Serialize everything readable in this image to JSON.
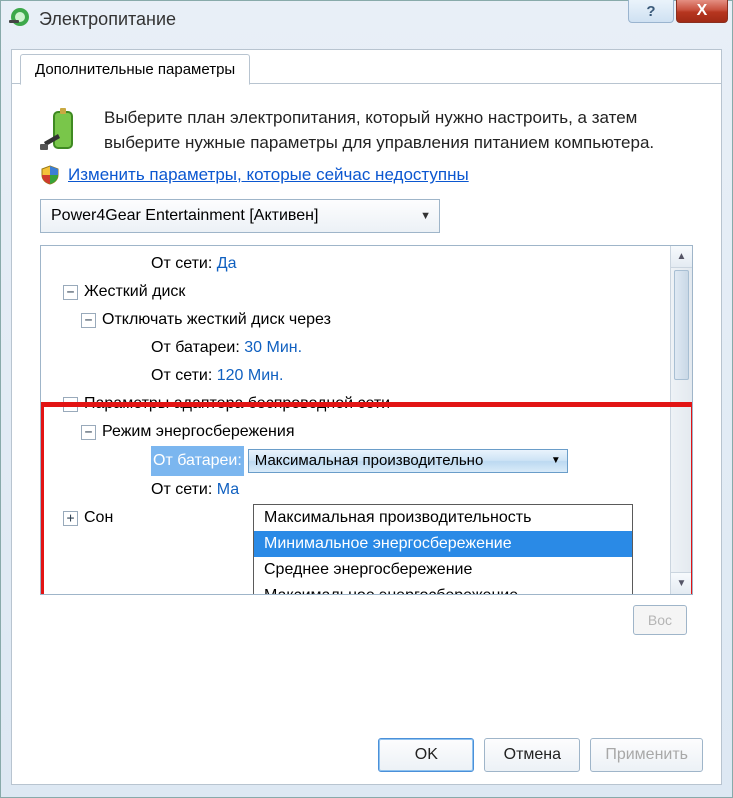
{
  "window": {
    "title": "Электропитание"
  },
  "tab": {
    "label": "Дополнительные параметры"
  },
  "intro": {
    "text": "Выберите план электропитания, который нужно настроить, а затем выберите нужные параметры для управления питанием компьютера."
  },
  "uac": {
    "link_text": "Изменить параметры, которые сейчас недоступны"
  },
  "plan_combo": {
    "selected": "Power4Gear Entertainment [Активен]"
  },
  "tree": {
    "row0": {
      "label": "От сети:",
      "value": "Да"
    },
    "hard_disk": {
      "label": "Жесткий диск",
      "turn_off": {
        "label": "Отключать жесткий диск через",
        "battery": {
          "label": "От батареи:",
          "value": "30 Мин."
        },
        "plugged": {
          "label": "От сети:",
          "value": "120 Мин."
        }
      }
    },
    "wifi": {
      "label": "Параметры адаптера беспроводной сети",
      "mode": {
        "label": "Режим энергосбережения",
        "battery": {
          "label": "От батареи:",
          "value": "Максимальная производительно"
        },
        "plugged": {
          "label": "От сети:",
          "value_prefix": "Ма"
        }
      }
    },
    "sleep": {
      "label": "Сон"
    }
  },
  "dropdown": {
    "opt0": "Максимальная производительность",
    "opt1": "Минимальное энергосбережение",
    "opt2": "Среднее энергосбережение",
    "opt3": "Максимальное энергосбережение"
  },
  "buttons": {
    "restore_partial": "Вос",
    "ok": "OK",
    "cancel": "Отмена",
    "apply": "Применить"
  }
}
